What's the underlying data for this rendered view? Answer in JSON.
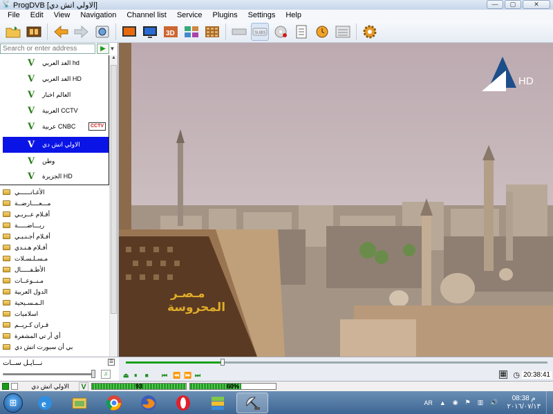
{
  "window": {
    "title": "ProgDVB [الاولي اتش دي]",
    "minimize": "—",
    "maximize": "▢",
    "close": "✕"
  },
  "menu": [
    "File",
    "Edit",
    "View",
    "Navigation",
    "Channel list",
    "Service",
    "Plugins",
    "Settings",
    "Help"
  ],
  "toolbar": {
    "icons": [
      "open-folder-icon",
      "film-icon",
      "back-arrow-icon",
      "forward-arrow-icon",
      "globe-icon",
      "tv-screen-icon",
      "tv-monitor-icon",
      "3d-icon",
      "multi-view-icon",
      "mosaic-icon",
      "device-icon",
      "subs-icon",
      "record-disc-icon",
      "epg-list-icon",
      "timer-clock-icon",
      "teletext-icon",
      "settings-gear-icon"
    ],
    "subs_label": "SUBS",
    "three_d_label": "3D"
  },
  "search": {
    "placeholder": "Search or enter address",
    "go": "▶",
    "drop": "▼"
  },
  "favorites": [
    {
      "name": "الغد العربي hd",
      "selected": false
    },
    {
      "name": "الغد العربي HD",
      "selected": false
    },
    {
      "name": "العالم اخبار",
      "selected": false
    },
    {
      "name": "العربية CCTV",
      "selected": false
    },
    {
      "name": "عربية CNBC",
      "selected": false
    },
    {
      "name": "الاولي اتش دي",
      "selected": true
    },
    {
      "name": "وطن",
      "selected": false
    },
    {
      "name": "الجزيرة HD",
      "selected": false
    }
  ],
  "cctv_badge": "CCTV",
  "folders": [
    "الأغـانــــــي",
    "مـــعــــارضــة",
    "أفـلام عــربـي",
    "ريـــاضـــــة",
    "أفـلام أجـنـبـي",
    "أفـلام هـنـدي",
    "مـسـلـسـلات",
    "الأطـفـــــال",
    "مـنــوعــات",
    "الدول العربية",
    "الـمـسـيحية",
    "اسلاميات",
    "قـران كـريــم",
    "أي أر تي المشفرة",
    "بي أن سبورت اتش دي"
  ],
  "bottom_left": {
    "group": "نـــايـل ســات",
    "volume_pct": 100
  },
  "video": {
    "channel_logo": "HD",
    "watermark_line1": "مـصـر",
    "watermark_line2": "المحروسة"
  },
  "playback": {
    "progress_pct": 23,
    "buttons": [
      "⏏",
      "⏸",
      "⏹",
      "⏮",
      "⏪",
      "⏩",
      "⏭"
    ],
    "time": "20:38:41"
  },
  "status": {
    "channel": "الاولي اتش دي",
    "signal_label": "93",
    "signal_pct": 100,
    "quality_label": "60%",
    "quality_pct": 60,
    "v_mark": "V"
  },
  "taskbar": {
    "apps": [
      "ie-icon",
      "file-explorer-icon",
      "chrome-icon",
      "firefox-icon",
      "opera-icon",
      "bluestacks-icon",
      "satellite-dish-icon"
    ],
    "lang": "AR",
    "time": "08:38 م",
    "date": "٢٠١٦/٠٧/١٣"
  },
  "colors": {
    "selection": "#0a14e6",
    "accent_green": "#1a9a1a",
    "taskbar": "#3d6693"
  }
}
